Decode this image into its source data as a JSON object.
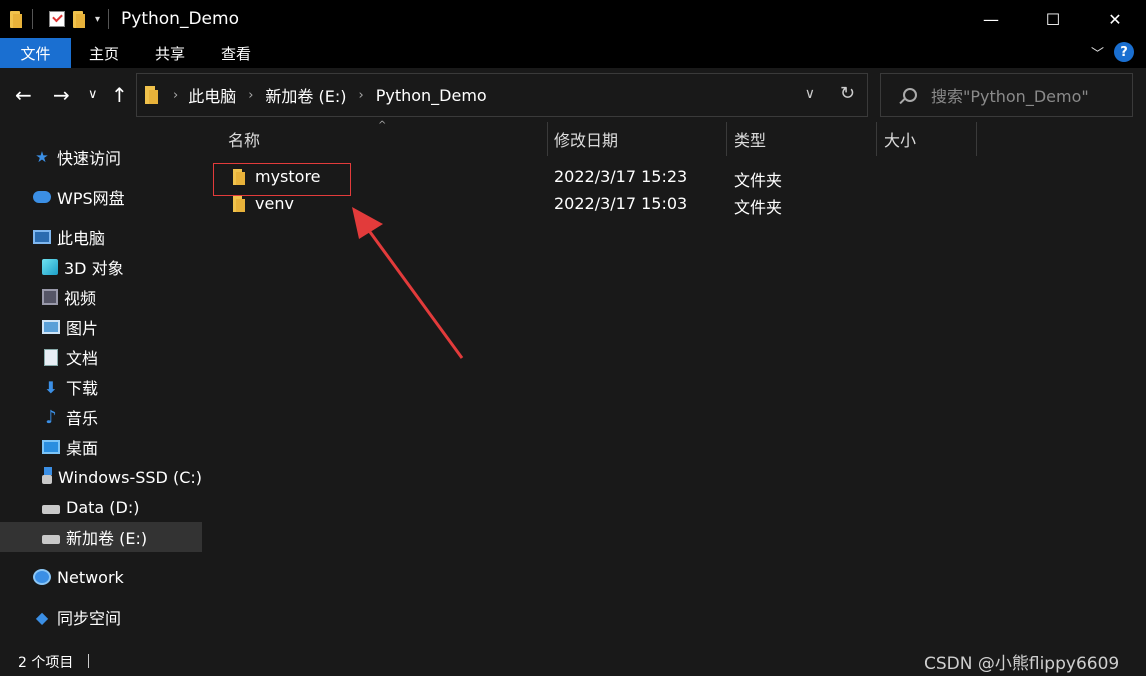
{
  "window": {
    "title": "Python_Demo",
    "minimize_glyph": "—",
    "maximize_glyph": "☐",
    "close_glyph": "✕"
  },
  "ribbon": {
    "tabs": [
      {
        "label": "文件",
        "active": true
      },
      {
        "label": "主页",
        "active": false
      },
      {
        "label": "共享",
        "active": false
      },
      {
        "label": "查看",
        "active": false
      }
    ],
    "help_label": "?"
  },
  "address": {
    "segments": [
      "此电脑",
      "新加卷 (E:)",
      "Python_Demo"
    ]
  },
  "search": {
    "placeholder": "搜索\"Python_Demo\""
  },
  "sidebar": {
    "items": [
      {
        "label": "快速访问",
        "icon": "star-icon"
      },
      {
        "label": "WPS网盘",
        "icon": "cloud-icon"
      },
      {
        "label": "此电脑",
        "icon": "computer-icon"
      },
      {
        "label": "3D 对象",
        "icon": "cube-icon"
      },
      {
        "label": "视频",
        "icon": "video-icon"
      },
      {
        "label": "图片",
        "icon": "picture-icon"
      },
      {
        "label": "文档",
        "icon": "document-icon"
      },
      {
        "label": "下载",
        "icon": "download-icon"
      },
      {
        "label": "音乐",
        "icon": "music-icon"
      },
      {
        "label": "桌面",
        "icon": "desktop-icon"
      },
      {
        "label": "Windows-SSD (C:)",
        "icon": "drive-icon"
      },
      {
        "label": "Data (D:)",
        "icon": "drive-icon"
      },
      {
        "label": "新加卷 (E:)",
        "icon": "drive-icon",
        "selected": true
      },
      {
        "label": "Network",
        "icon": "network-icon"
      },
      {
        "label": "同步空间",
        "icon": "sync-icon"
      }
    ]
  },
  "filelist": {
    "columns": [
      "名称",
      "修改日期",
      "类型",
      "大小"
    ],
    "rows": [
      {
        "name": "mystore",
        "modified": "2022/3/17 15:23",
        "type": "文件夹",
        "size": ""
      },
      {
        "name": "venv",
        "modified": "2022/3/17 15:03",
        "type": "文件夹",
        "size": ""
      }
    ]
  },
  "status": {
    "item_count": "2 个项目"
  },
  "watermark": "CSDN @小熊flippy6609",
  "colors": {
    "accent": "#1a6fd1",
    "highlight": "#e23b3b",
    "background": "#191919"
  }
}
